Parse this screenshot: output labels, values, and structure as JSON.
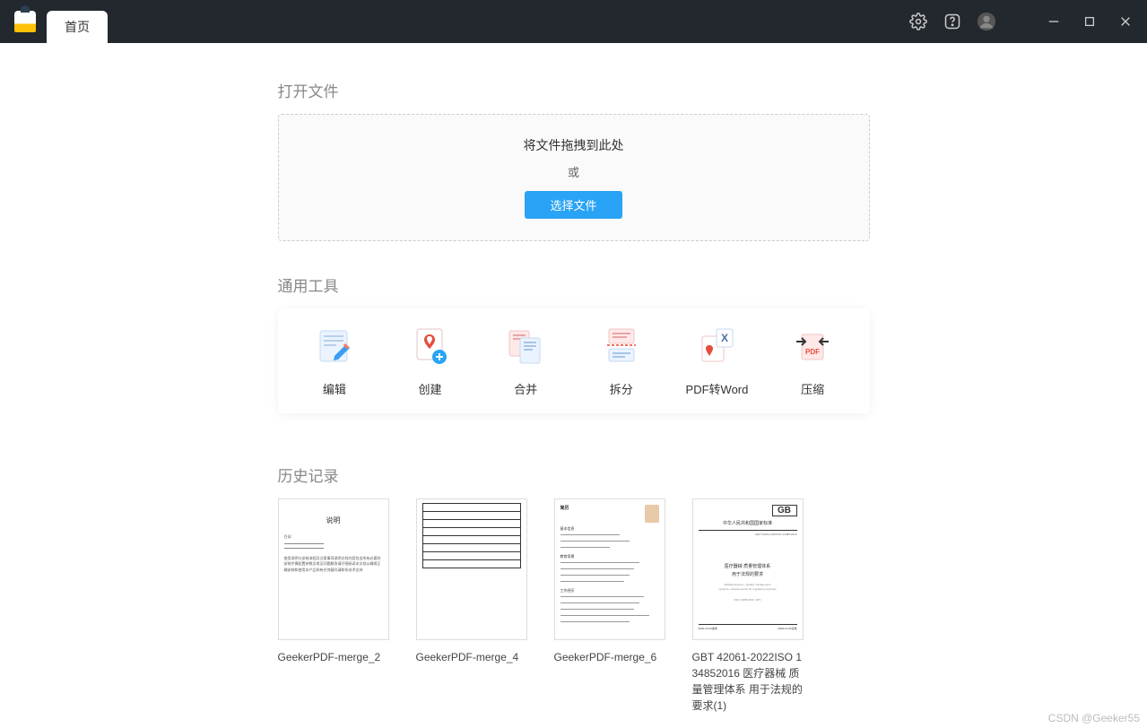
{
  "tab": {
    "label": "首页"
  },
  "open_file": {
    "title": "打开文件",
    "drag_text": "将文件拖拽到此处",
    "or": "或",
    "choose_button": "选择文件"
  },
  "tools": {
    "title": "通用工具",
    "items": [
      {
        "name": "edit",
        "label": "编辑"
      },
      {
        "name": "create",
        "label": "创建"
      },
      {
        "name": "merge",
        "label": "合并"
      },
      {
        "name": "split",
        "label": "拆分"
      },
      {
        "name": "pdf2word",
        "label": "PDF转Word"
      },
      {
        "name": "compress",
        "label": "压缩"
      }
    ]
  },
  "history": {
    "title": "历史记录",
    "items": [
      {
        "label": "GeekerPDF-merge_2",
        "thumb_title": "说明"
      },
      {
        "label": "GeekerPDF-merge_4"
      },
      {
        "label": "GeekerPDF-merge_6"
      },
      {
        "label": "GBT 42061-2022ISO 134852016 医疗器械 质量管理体系 用于法规的要求(1)",
        "thumb_gb": "GB",
        "thumb_header": "中华人民共和国国家标准",
        "thumb_main1": "医疗器械 质量管理体系",
        "thumb_main2": "用于法规的要求"
      }
    ]
  },
  "watermark": "CSDN @Geeker55"
}
